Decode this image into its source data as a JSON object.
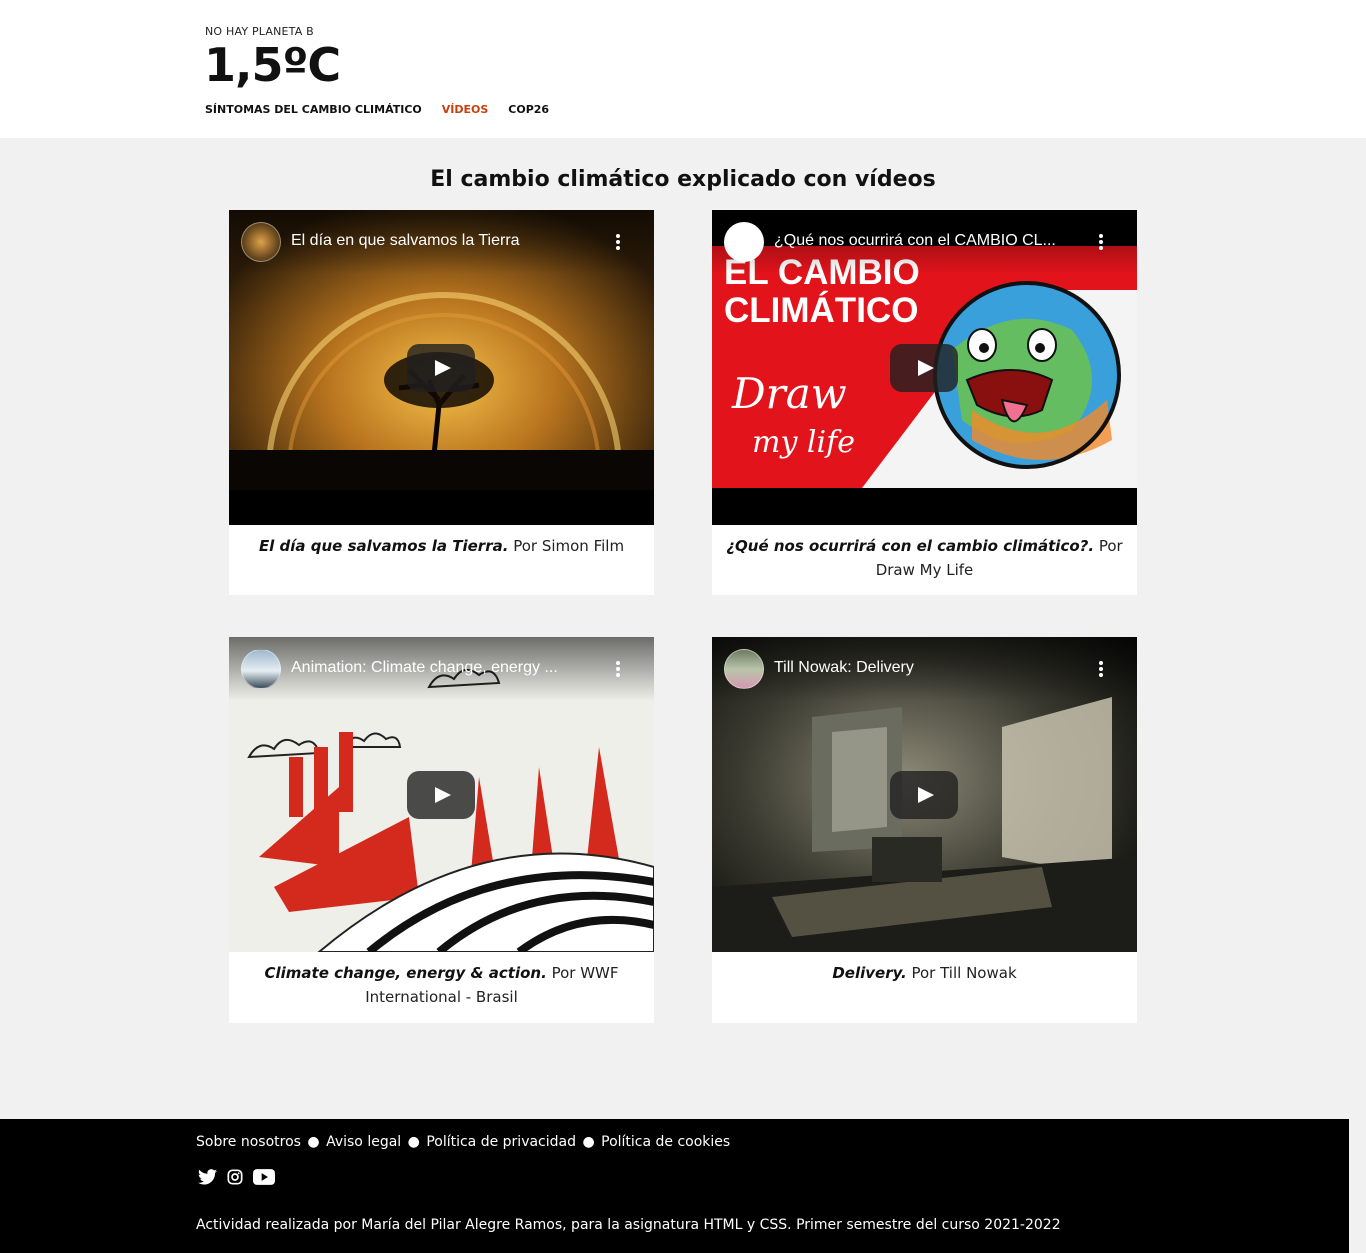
{
  "header": {
    "tagline": "NO HAY PLANETA B",
    "logo": "1,5ºC",
    "nav": [
      {
        "label": "SÍNTOMAS DEL CAMBIO CLIMÁTICO",
        "active": false
      },
      {
        "label": "VÍDEOS",
        "active": true
      },
      {
        "label": "COP26",
        "active": false
      }
    ]
  },
  "main": {
    "title": "El cambio climático explicado con vídeos",
    "videos": [
      {
        "player_title": "El día en que salvamos la Tierra",
        "caption_title": "El día que salvamos la Tierra.",
        "caption_author": " Por Simon Film"
      },
      {
        "player_title": "¿Qué nos ocurrirá con el CAMBIO CL...",
        "caption_title": "¿Qué nos ocurrirá con el cambio climático?.",
        "caption_author": " Por Draw My Life",
        "thumb_text_1": "EL CAMBIO",
        "thumb_text_2": "CLIMÁTICO",
        "thumb_text_3": "Draw",
        "thumb_text_4": "my life"
      },
      {
        "player_title": "Animation: Climate change, energy ...",
        "caption_title": "Climate change, energy & action.",
        "caption_author": " Por WWF International - Brasil"
      },
      {
        "player_title": "Till Nowak: Delivery",
        "caption_title": "Delivery.",
        "caption_author": " Por Till Nowak"
      }
    ]
  },
  "footer": {
    "links": [
      "Sobre nosotros",
      "Aviso legal",
      "Política de privacidad",
      "Política de cookies"
    ],
    "separator": "●",
    "social_icons": [
      "twitter-icon",
      "instagram-icon",
      "youtube-icon"
    ],
    "credit": "Actividad realizada por María del Pilar Alegre Ramos, para la asignatura HTML y CSS. Primer semestre del curso 2021-2022"
  },
  "colors": {
    "accent": "#c8400f",
    "footer_bg": "#000000",
    "page_bg": "#f1f1f1"
  }
}
